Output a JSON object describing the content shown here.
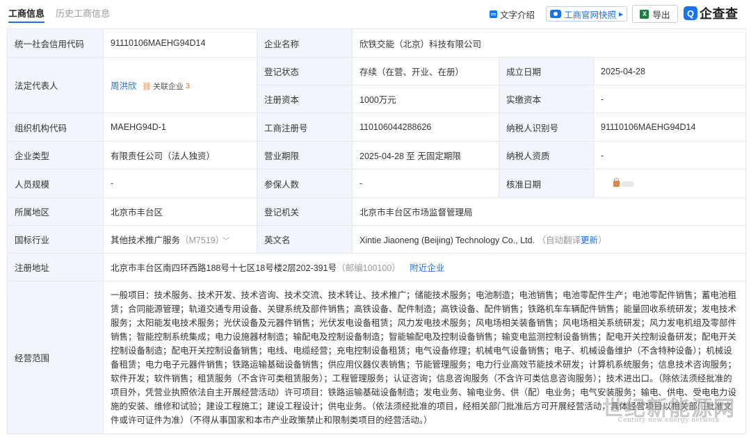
{
  "tabs": [
    {
      "label": "工商信息"
    },
    {
      "label": "历史工商信息"
    }
  ],
  "toolbar": {
    "text_intro": "文字介绍",
    "snapshot": "工商官网快照",
    "export": "导出",
    "export_icon": "X",
    "logo_mark": "Q",
    "logo_text": "企查查"
  },
  "rows": {
    "credit_code": {
      "label": "统一社会信用代码",
      "value": "91110106MAEHG94D14"
    },
    "company_name": {
      "label": "企业名称",
      "value": "欣铁交能（北京）科技有限公司"
    },
    "legal_rep": {
      "label": "法定代表人",
      "value": "周洪欣",
      "tag": "关联企业",
      "tag_count": "3"
    },
    "reg_status": {
      "label": "登记状态",
      "value": "存续（在营、开业、在册）"
    },
    "est_date": {
      "label": "成立日期",
      "value": "2025-04-28"
    },
    "reg_capital": {
      "label": "注册资本",
      "value": "1000万元"
    },
    "paid_capital": {
      "label": "实缴资本",
      "value": "-"
    },
    "org_code": {
      "label": "组织机构代码",
      "value": "MAEHG94D-1"
    },
    "reg_no": {
      "label": "工商注册号",
      "value": "110106044288626"
    },
    "taxpayer_id": {
      "label": "纳税人识别号",
      "value": "91110106MAEHG94D14"
    },
    "company_type": {
      "label": "企业类型",
      "value": "有限责任公司（法人独资）"
    },
    "business_term": {
      "label": "营业期限",
      "value": "2025-04-28 至 无固定期限"
    },
    "taxpayer_qual": {
      "label": "纳税人资质",
      "value": "-"
    },
    "staff_size": {
      "label": "人员规模",
      "value": "-"
    },
    "insured": {
      "label": "参保人数",
      "value": "-"
    },
    "approval_date": {
      "label": "核准日期",
      "value": ""
    },
    "region": {
      "label": "所属地区",
      "value": "北京市丰台区"
    },
    "reg_authority": {
      "label": "登记机关",
      "value": "北京市丰台区市场监督管理局"
    },
    "industry": {
      "label": "国标行业",
      "value": "其他技术推广服务",
      "code": "（M7519）"
    },
    "english_name": {
      "label": "英文名",
      "value": "Xintie Jiaoneng (Beijing) Technology Co., Ltd.",
      "note": "（自动翻译",
      "update": "更新",
      "note_end": "）"
    },
    "address": {
      "label": "注册地址",
      "value": "北京市丰台区南四环西路188号十七区18号楼2层202-391号",
      "postcode": "（邮编100100）",
      "nearby": "附近企业"
    },
    "scope": {
      "label": "经营范围",
      "value": "一般项目：技术服务、技术开发、技术咨询、技术交流、技术转让、技术推广；储能技术服务；电池制造；电池销售；电池零配件生产；电池零配件销售；蓄电池租赁；合同能源管理；轨道交通专用设备、关键系统及部件销售；高铁设备、配件制造；高铁设备、配件销售；铁路机车车辆配件销售；能量回收系统研发；发电技术服务；太阳能发电技术服务；光伏设备及元器件销售；光伏发电设备租赁；风力发电技术服务；风电场相关装备销售；风电场相关系统研发；风力发电机组及零部件销售；智能控制系统集成；电力设施器材制造；输配电及控制设备制造；智能输配电及控制设备销售；输变电监测控制设备销售；配电开关控制设备研发；配电开关控制设备制造；配电开关控制设备销售；电线、电缆经营；充电控制设备租赁；电气设备修理；机械电气设备销售；电子、机械设备维护（不含特种设备）；机械设备租赁；电力电子元器件销售；铁路运输基础设备销售；供应用仪器仪表销售；节能管理服务；电力行业高效节能技术研发；计算机系统服务；信息技术咨询服务；软件开发；软件销售；租赁服务（不含许可类租赁服务）；工程管理服务；认证咨询；信息咨询服务（不含许可类信息咨询服务）；技术进出口。（除依法须经批准的项目外，凭营业执照依法自主开展经营活动）许可项目：铁路运输基础设备制造；发电业务、输电业务、供（配）电业务；电气安装服务；输电、供电、受电电力设施的安装、维修和试验；建设工程施工；建设工程设计；供电业务。（依法须经批准的项目，经相关部门批准后方可开展经营活动，具体经营项目以相关部门批准文件或许可证件为准）（不得从事国家和本市产业政策禁止和限制类项目的经营活动。）"
    }
  },
  "watermark": {
    "main": "世纪新能源网",
    "sub": "Century new energy network"
  },
  "colors": {
    "accent": "#1a73e8",
    "label_bg": "#f2f5fb",
    "tag_orange": "#ff6a00"
  }
}
